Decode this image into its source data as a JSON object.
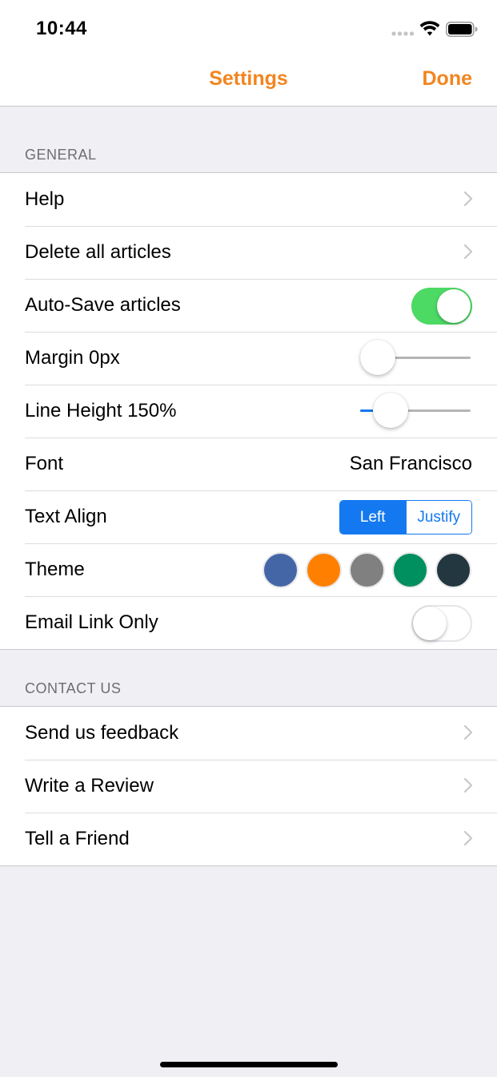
{
  "status_bar": {
    "time": "10:44",
    "icons": [
      "signal-dots-icon",
      "wifi-icon",
      "battery-icon"
    ]
  },
  "nav": {
    "title": "Settings",
    "done_label": "Done",
    "accent_color": "#f2851f"
  },
  "general": {
    "header": "GENERAL",
    "help": {
      "label": "Help"
    },
    "delete_all": {
      "label": "Delete all articles"
    },
    "auto_save": {
      "label": "Auto-Save articles",
      "on": true
    },
    "margin": {
      "label": "Margin 0px",
      "fraction": 0.0
    },
    "line_height": {
      "label": "Line Height 150%",
      "fraction": 0.17
    },
    "font": {
      "label": "Font",
      "value": "San Francisco"
    },
    "text_align": {
      "label": "Text Align",
      "options": [
        "Left",
        "Justify"
      ],
      "selected": "Left"
    },
    "theme": {
      "label": "Theme",
      "colors": [
        "#4466a6",
        "#ff8000",
        "#808080",
        "#008f5e",
        "#233740"
      ]
    },
    "email_link_only": {
      "label": "Email Link Only",
      "on": false
    }
  },
  "contact": {
    "header": "CONTACT US",
    "feedback": {
      "label": "Send us feedback"
    },
    "review": {
      "label": "Write a Review"
    },
    "friend": {
      "label": "Tell a Friend"
    }
  },
  "colors": {
    "toggle_on": "#4cd964",
    "ios_blue": "#1479f0",
    "background": "#efeff4"
  }
}
